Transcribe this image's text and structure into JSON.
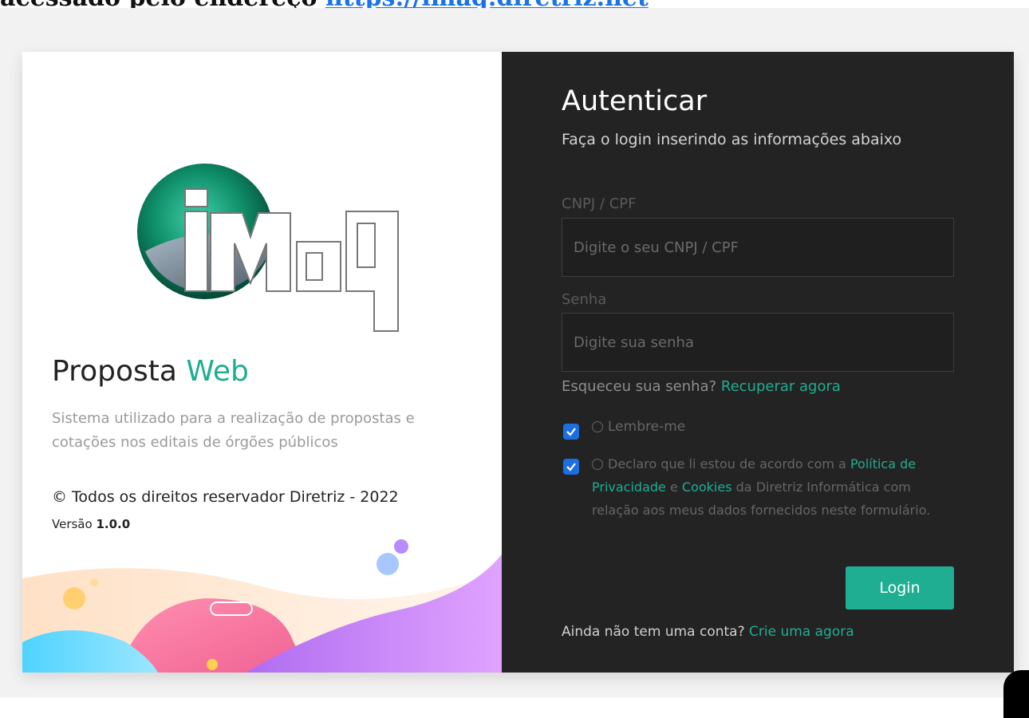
{
  "banner": {
    "prefix": "acessado pelo endereço ",
    "link": "https://imaq.diretriz.net"
  },
  "brand": {
    "logo_text": "iMaq",
    "title_main": "Proposta",
    "title_accent": "Web",
    "description": "Sistema utilizado para a realização de propostas e cotações nos editais de órgões públicos",
    "copyright": "© Todos os direitos reservador Diretriz - 2022",
    "version_label": "Versão",
    "version_value": "1.0.0"
  },
  "auth": {
    "title": "Autenticar",
    "subtitle": "Faça o login inserindo as informações abaixo",
    "cnpj_label": "CNPJ / CPF",
    "cnpj_placeholder": "Digite o seu CNPJ / CPF",
    "cnpj_value": "",
    "password_label": "Senha",
    "password_placeholder": "Digite sua senha",
    "password_value": "",
    "forgot_text": "Esqueceu sua senha?",
    "forgot_link": "Recuperar agora",
    "remember_label": "Lembre-me",
    "remember_checked": true,
    "terms_prefix": "Declaro que li estou de acordo com a",
    "privacy_link": "Política de Privacidade",
    "terms_and": "e",
    "cookies_link": "Cookies",
    "terms_suffix": "da Diretriz Informática com relação aos meus dados fornecidos neste formulário.",
    "terms_checked": true,
    "login_button": "Login",
    "signup_text": "Ainda não tem uma conta?",
    "signup_link": "Crie uma agora"
  },
  "colors": {
    "accent": "#1fae91",
    "panel_dark": "#232323",
    "checkbox": "#1d6fe0"
  },
  "icons": [
    "clock-icon",
    "info-icon",
    "check-icon"
  ]
}
